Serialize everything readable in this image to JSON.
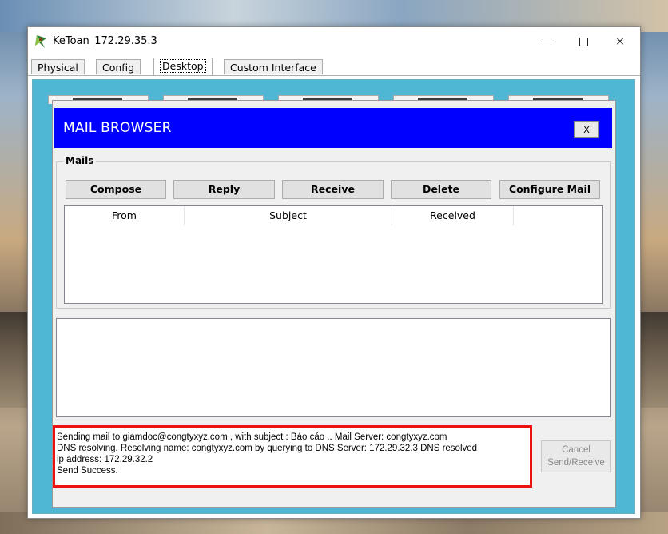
{
  "window": {
    "title": "KeToan_172.29.35.3"
  },
  "controls": {
    "minimize": "minimize",
    "maximize": "maximize",
    "close": "×"
  },
  "tabs": [
    {
      "label": "Physical"
    },
    {
      "label": "Config"
    },
    {
      "label": "Desktop"
    },
    {
      "label": "Custom Interface"
    }
  ],
  "mail_browser": {
    "title": "MAIL BROWSER",
    "close_label": "X",
    "mails_label": "Mails",
    "buttons": {
      "compose": "Compose",
      "reply": "Reply",
      "receive": "Receive",
      "delete": "Delete",
      "configure": "Configure Mail"
    },
    "columns": [
      "From",
      "Subject",
      "Received"
    ],
    "log": [
      "Sending mail to giamdoc@congtyxyz.com , with subject : Báo cáo ..  Mail Server: congtyxyz.com",
      "DNS resolving. Resolving name: congtyxyz.com by querying to DNS Server: 172.29.32.3  DNS resolved",
      "ip address: 172.29.32.2",
      "Send Success."
    ],
    "cancel_label_1": "Cancel",
    "cancel_label_2": "Send/Receive"
  },
  "colors": {
    "header_blue": "#0000fe",
    "desktop_bg": "#4fb7d3",
    "log_border": "#ee1111"
  }
}
